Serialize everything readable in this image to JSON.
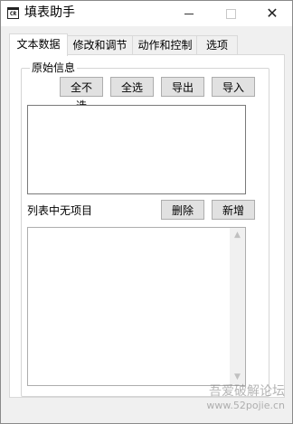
{
  "window": {
    "title": "填表助手",
    "icon": "app-form-icon",
    "icon_text": "CR",
    "minimize_icon": "minimize-icon",
    "maximize_icon": "maximize-icon",
    "close_icon": "close-icon",
    "close_glyph": "✕"
  },
  "tabs": [
    {
      "label": "文本数据",
      "active": true
    },
    {
      "label": "修改和调节",
      "active": false
    },
    {
      "label": "动作和控制",
      "active": false
    },
    {
      "label": "选项",
      "active": false
    }
  ],
  "original_info": {
    "legend": "原始信息",
    "buttons": {
      "deselect_all": "全不选",
      "select_all": "全选",
      "export": "导出",
      "import": "导入"
    }
  },
  "list": {
    "status": "列表中无项目",
    "delete_label": "删除",
    "add_label": "新增"
  },
  "watermark": {
    "text": "吾爱破解论坛",
    "url": "www.52pojie.cn"
  }
}
